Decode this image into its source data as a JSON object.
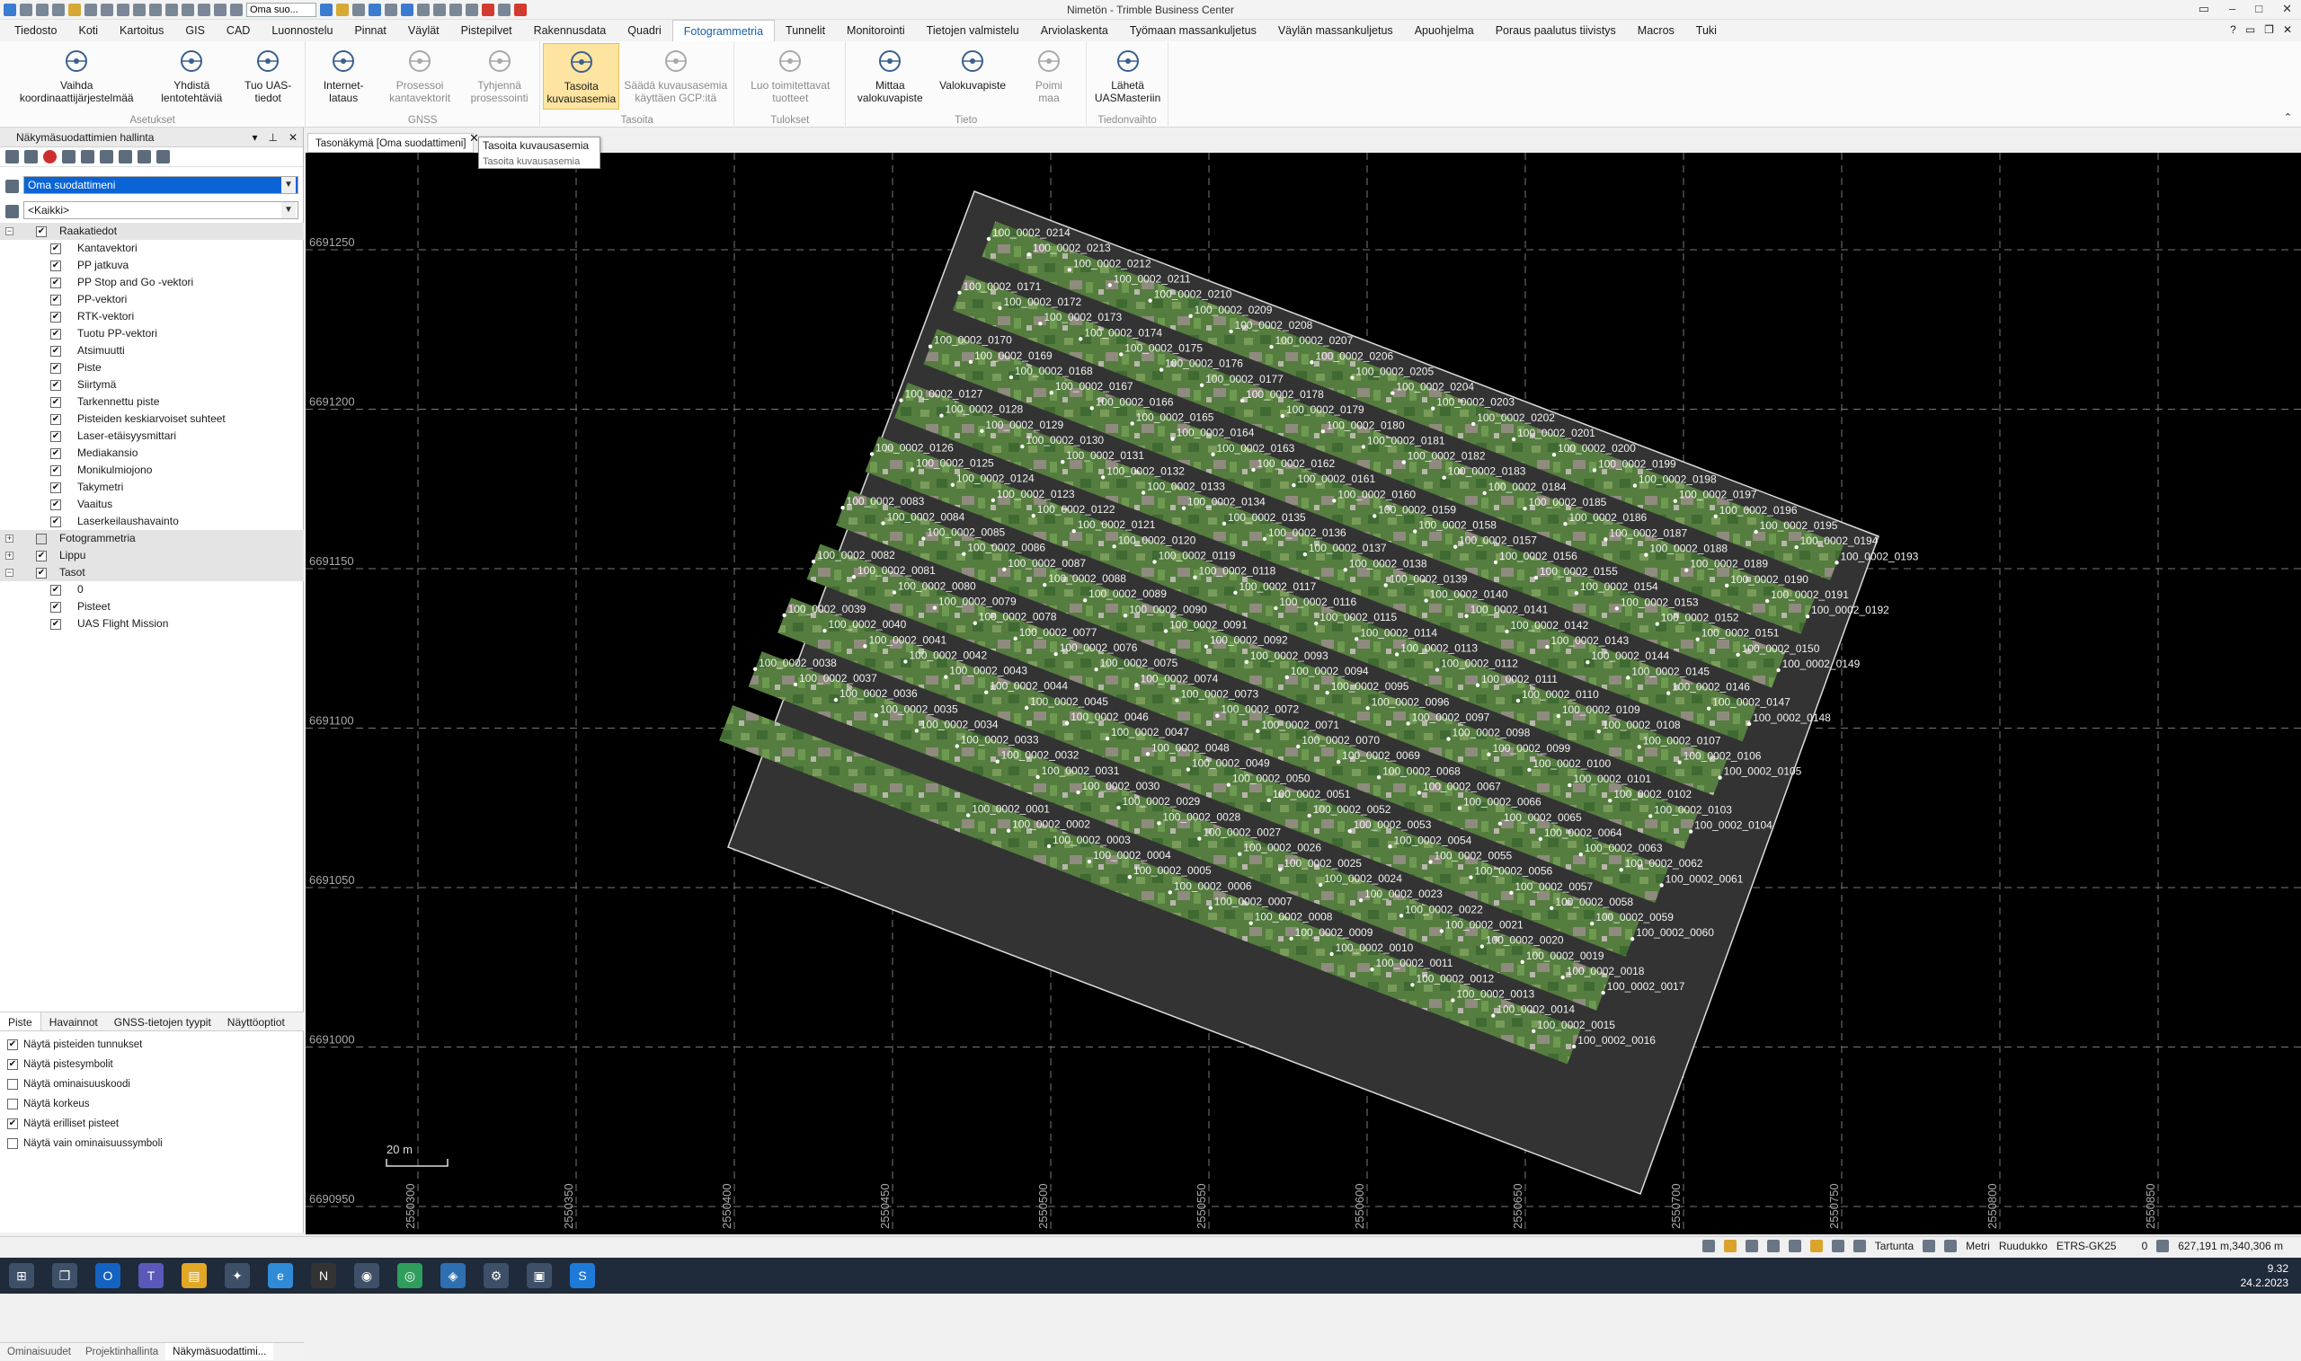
{
  "app": {
    "title": "Nimetön - Trimble Business Center",
    "qat_filter": "Oma suo..."
  },
  "menu": [
    "Tiedosto",
    "Koti",
    "Kartoitus",
    "GIS",
    "CAD",
    "Luonnostelu",
    "Pinnat",
    "Väylät",
    "Pistepilvet",
    "Rakennusdata",
    "Quadri",
    "Fotogrammetria",
    "Tunnelit",
    "Monitorointi",
    "Tietojen valmistelu",
    "Arviolaskenta",
    "Työmaan massankuljetus",
    "Väylän massankuljetus",
    "Apuohjelma",
    "Poraus paalutus tiivistys",
    "Macros",
    "Tuki"
  ],
  "menu_active": "Fotogrammetria",
  "ribbon": {
    "groups": [
      {
        "label": "Asetukset",
        "buttons": [
          {
            "l1": "Vaihda",
            "l2": "koordinaattijärjestelmää",
            "icon": "globe-icon",
            "dim": false
          },
          {
            "l1": "Yhdistä",
            "l2": "lentotehtäviä",
            "icon": "drone-merge-icon",
            "dim": false
          },
          {
            "l1": "Tuo UAS-",
            "l2": "tiedot",
            "icon": "drone-import-icon",
            "dim": false
          }
        ]
      },
      {
        "label": "GNSS",
        "buttons": [
          {
            "l1": "Internet-",
            "l2": "lataus",
            "icon": "cloud-download-icon",
            "dim": false
          },
          {
            "l1": "Prosessoi",
            "l2": "kantavektorit",
            "icon": "baseline-process-icon",
            "dim": true
          },
          {
            "l1": "Tyhjennä",
            "l2": "prosessointi",
            "icon": "clear-processing-icon",
            "dim": true
          }
        ]
      },
      {
        "label": "Tasoita",
        "buttons": [
          {
            "l1": "Tasoita",
            "l2": "kuvausasemia",
            "icon": "adjust-stations-icon",
            "dim": false,
            "active": true
          },
          {
            "l1": "Säädä kuvausasemia",
            "l2": "käyttäen GCP:itä",
            "icon": "gcp-adjust-icon",
            "dim": true
          }
        ]
      },
      {
        "label": "Tulokset",
        "buttons": [
          {
            "l1": "Luo toimitettavat",
            "l2": "tuotteet",
            "icon": "deliverables-icon",
            "dim": true
          }
        ]
      },
      {
        "label": "Tieto",
        "buttons": [
          {
            "l1": "Mittaa",
            "l2": "valokuvapiste",
            "icon": "measure-photo-point-icon",
            "dim": false
          },
          {
            "l1": "Valokuvapiste",
            "l2": "",
            "icon": "photo-point-icon",
            "dim": false
          },
          {
            "l1": "Poimi",
            "l2": "maa",
            "icon": "pick-ground-icon",
            "dim": true
          }
        ]
      },
      {
        "label": "Tiedonvaihto",
        "buttons": [
          {
            "l1": "Lähetä",
            "l2": "UASMasteriin",
            "icon": "send-uasmaster-icon",
            "dim": false
          }
        ]
      }
    ]
  },
  "panel": {
    "title": "Näkymäsuodattimien hallinta",
    "filter": "Oma suodattimeni",
    "scope": "<Kaikki>",
    "groups": [
      {
        "name": "Raakatiedot",
        "open": true,
        "items": [
          "Kantavektori",
          "PP jatkuva",
          "PP Stop and Go -vektori",
          "PP-vektori",
          "RTK-vektori",
          "Tuotu PP-vektori",
          "Atsimuutti",
          "Piste",
          "Siirtymä",
          "Tarkennettu piste",
          "Pisteiden keskiarvoiset suhteet",
          "Laser-etäisyysmittari",
          "Mediakansio",
          "Monikulmiojono",
          "Takymetri",
          "Vaaitus",
          "Laserkeilaushavainto"
        ]
      },
      {
        "name": "Fotogrammetria",
        "open": false,
        "items": []
      },
      {
        "name": "Lippu",
        "open": false,
        "items": []
      },
      {
        "name": "Tasot",
        "open": true,
        "items": [
          "0",
          "Pisteet",
          "UAS Flight Mission"
        ]
      }
    ],
    "tabs": [
      "Piste",
      "Havainnot",
      "GNSS-tietojen tyypit",
      "Näyttöoptiot"
    ],
    "options": [
      {
        "label": "Näytä pisteiden tunnukset",
        "checked": true
      },
      {
        "label": "Näytä pistesymbolit",
        "checked": true
      },
      {
        "label": "Näytä ominaisuuskoodi",
        "checked": false
      },
      {
        "label": "Näytä korkeus",
        "checked": false
      },
      {
        "label": "Näytä erilliset pisteet",
        "checked": true
      },
      {
        "label": "Näytä vain ominaisuussymboli",
        "checked": false
      }
    ],
    "bottom_tabs": [
      "Ominaisuudet",
      "Projektinhallinta",
      "Näkymäsuodattimi..."
    ]
  },
  "view": {
    "tab": "Tasonäkymä [Oma suodattimeni]",
    "tooltip_title": "Tasoita kuvausasemia",
    "tooltip_sub": "Tasoita kuvausasemia",
    "scale_label": "20 m",
    "y_ticks": [
      6691250,
      6691200,
      6691150,
      6691100,
      6691050,
      6691000,
      6690950
    ],
    "x_ticks": [
      2550300,
      2550350,
      2550400,
      2550450,
      2550500,
      2550550,
      2550600,
      2550650,
      2550700,
      2550750,
      2550800,
      2550850
    ],
    "label_prefix": "100_0002_",
    "first_station": 1,
    "last_station": 214,
    "strips": 10
  },
  "status": {
    "snap": "Tartunta",
    "unit": "Metri",
    "grid": "Ruudukko",
    "crs": "ETRS-GK25",
    "zero": "0",
    "coords": "627,191 m,340,306 m"
  },
  "taskbar": {
    "time": "9.32",
    "date": "24.2.2023"
  },
  "colors": {
    "accent": "#1b5ea8",
    "ribbon_active": "#fde4a0",
    "canvas": "#000000",
    "ortho_green": "#5d8a45"
  }
}
